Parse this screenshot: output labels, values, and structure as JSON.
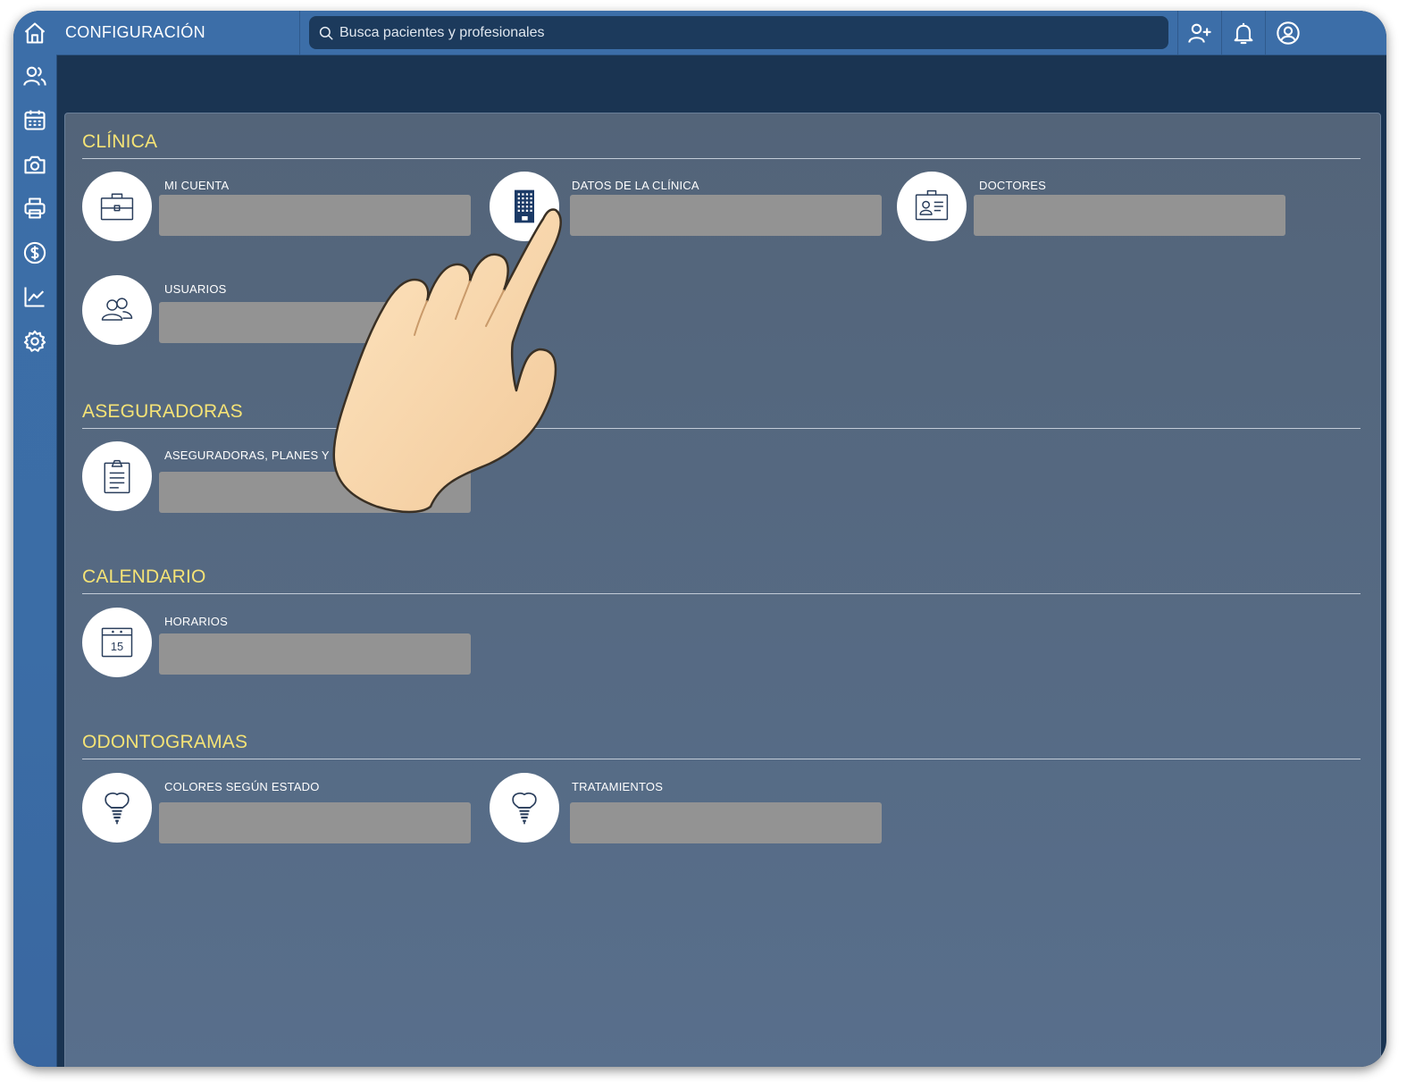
{
  "topbar": {
    "title": "CONFIGURACIÓN",
    "search_placeholder": "Busca pacientes y profesionales",
    "icons": [
      "add-user-icon",
      "bell-icon",
      "user-circle-icon"
    ]
  },
  "sidebar": {
    "icons": [
      "home-icon",
      "patients-icon",
      "calendar-icon",
      "camera-icon",
      "printer-icon",
      "dollar-icon",
      "chart-icon",
      "settings-icon"
    ]
  },
  "sections": {
    "clinica": {
      "title": "CLÍNICA",
      "items": [
        {
          "label": "MI CUENTA",
          "icon": "briefcase-icon"
        },
        {
          "label": "DATOS DE LA CLÍNICA",
          "icon": "building-icon"
        },
        {
          "label": "DOCTORES",
          "icon": "id-card-icon"
        },
        {
          "label": "USUARIOS",
          "icon": "users-icon"
        }
      ]
    },
    "aseguradoras": {
      "title": "ASEGURADORAS",
      "items": [
        {
          "label": "ASEGURADORAS, PLANES Y",
          "icon": "clipboard-icon"
        }
      ]
    },
    "calendario": {
      "title": "CALENDARIO",
      "items": [
        {
          "label": "HORARIOS",
          "icon": "calendar-15-icon",
          "day": "15"
        }
      ]
    },
    "odontogramas": {
      "title": "ODONTOGRAMAS",
      "items": [
        {
          "label": "COLORES SEGÚN ESTADO",
          "icon": "tooth-implant-icon"
        },
        {
          "label": "TRATAMIENTOS",
          "icon": "tooth-implant-icon"
        }
      ]
    }
  },
  "colors": {
    "accent_title": "#f5e376",
    "sidebar": "#3c6ea8",
    "topbar": "#3c6ea8",
    "background": "#1a3452",
    "panel": "#566b86",
    "placeholder_bar": "#939393"
  }
}
